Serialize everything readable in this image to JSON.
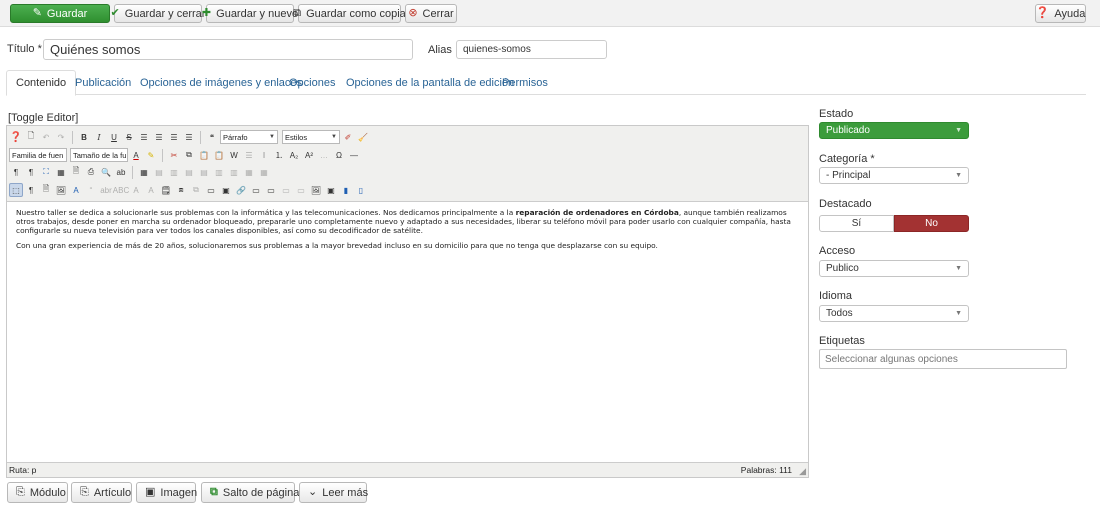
{
  "toolbar": {
    "save": "Guardar",
    "save_close": "Guardar y cerrar",
    "save_new": "Guardar y nuevo",
    "save_copy": "Guardar como copia",
    "close": "Cerrar",
    "help": "Ayuda"
  },
  "form": {
    "title_label": "Título *",
    "title_value": "Quiénes somos",
    "alias_label": "Alias",
    "alias_value": "quienes-somos"
  },
  "tabs": [
    {
      "label": "Contenido",
      "active": true
    },
    {
      "label": "Publicación"
    },
    {
      "label": "Opciones de imágenes y enlaces"
    },
    {
      "label": "Opciones"
    },
    {
      "label": "Opciones de la pantalla de edición"
    },
    {
      "label": "Permisos"
    }
  ],
  "editor": {
    "toggle_label": "[Toggle Editor]",
    "format_select": "Párrafo",
    "styles_select": "Estilos",
    "font_family_select": "Familia de fuen",
    "font_size_select": "Tamaño de la fu",
    "paragraph1_before": "Nuestro taller se dedica a solucionarle sus problemas con la informática y las telecomunicaciones. Nos dedicamos principalmente a la ",
    "paragraph1_bold": "reparación de ordenadores en Córdoba",
    "paragraph1_after": ", aunque también realizamos otros trabajos, desde poner en marcha su ordenador bloqueado, prepararle uno completamente nuevo y adaptado a sus necesidades, liberar su teléfono móvil para poder usarlo con cualquier compañía, hasta configurarle su nueva televisión para ver todos los canales disponibles, así como su decodificador de satélite.",
    "paragraph2": "Con una gran experiencia de más de 20 años, solucionaremos sus problemas a la mayor brevedad incluso en su domicilio para que no tenga que desplazarse con su equipo.",
    "path": "Ruta: p",
    "word_count": "Palabras: 111"
  },
  "insert_buttons": {
    "module": "Módulo",
    "article": "Artículo",
    "image": "Imagen",
    "page_break": "Salto de página",
    "read_more": "Leer más"
  },
  "sidebar": {
    "state_label": "Estado",
    "state_value": "Publicado",
    "category_label": "Categoría *",
    "category_value": "- Principal",
    "featured_label": "Destacado",
    "featured_yes": "Sí",
    "featured_no": "No",
    "access_label": "Acceso",
    "access_value": "Publico",
    "language_label": "Idioma",
    "language_value": "Todos",
    "tags_label": "Etiquetas",
    "tags_placeholder": "Seleccionar algunas opciones"
  },
  "colors": {
    "save_green": "#3c9c3c",
    "featured_red": "#a33232",
    "link_blue": "#2a6496"
  }
}
